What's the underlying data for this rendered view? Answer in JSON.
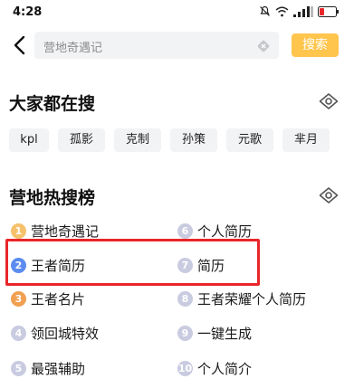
{
  "status_bar": {
    "time": "4:28",
    "icons": [
      "mute-icon",
      "wifi-icon",
      "signal-icon",
      "battery-icon"
    ]
  },
  "header": {
    "search_text": "营地奇遇记",
    "search_button": "搜索"
  },
  "trending": {
    "title": "大家都在搜",
    "chips": [
      "kpl",
      "孤影",
      "克制",
      "孙策",
      "元歌",
      "芈月"
    ]
  },
  "hot_list": {
    "title": "营地热搜榜",
    "items": [
      {
        "rank": "1",
        "label": "营地奇遇记",
        "badge_color": "#f5c26b"
      },
      {
        "rank": "2",
        "label": "王者简历",
        "badge_color": "#5b8cf0"
      },
      {
        "rank": "3",
        "label": "王者名片",
        "badge_color": "#f0a050"
      },
      {
        "rank": "4",
        "label": "领回城特效",
        "badge_color": "#c9cbe0"
      },
      {
        "rank": "5",
        "label": "最强辅助",
        "badge_color": "#c9cbe0"
      },
      {
        "rank": "6",
        "label": "个人简历",
        "badge_color": "#c9cbe0"
      },
      {
        "rank": "7",
        "label": "简历",
        "badge_color": "#c9cbe0"
      },
      {
        "rank": "8",
        "label": "王者荣耀个人简历",
        "badge_color": "#c9cbe0"
      },
      {
        "rank": "9",
        "label": "一键生成",
        "badge_color": "#c9cbe0"
      },
      {
        "rank": "10",
        "label": "个人简介",
        "badge_color": "#c9cbe0"
      }
    ]
  },
  "colors": {
    "accent": "#ffc54d",
    "highlight": "#e8262a"
  }
}
